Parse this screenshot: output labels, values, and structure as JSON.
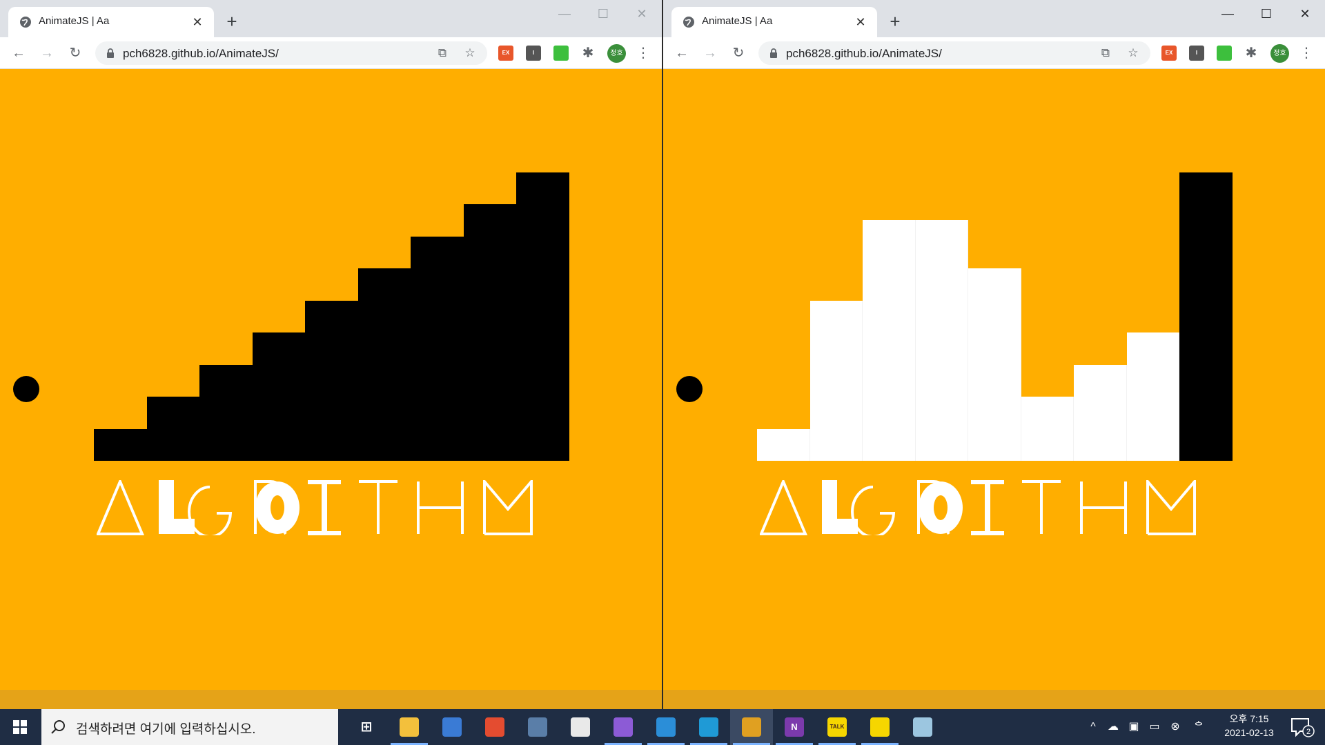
{
  "windows": [
    {
      "id": "left",
      "tab_title": "AnimateJS | Aa",
      "url": "pch6828.github.io/AnimateJS/",
      "avatar": "정호",
      "bars": [
        {
          "value": 1,
          "color": "#000000"
        },
        {
          "value": 2,
          "color": "#000000"
        },
        {
          "value": 3,
          "color": "#000000"
        },
        {
          "value": 4,
          "color": "#000000"
        },
        {
          "value": 5,
          "color": "#000000"
        },
        {
          "value": 6,
          "color": "#000000"
        },
        {
          "value": 7,
          "color": "#000000"
        },
        {
          "value": 8,
          "color": "#000000"
        },
        {
          "value": 9,
          "color": "#000000"
        }
      ],
      "logo_text": "ALGORITHM"
    },
    {
      "id": "right",
      "tab_title": "AnimateJS | Aa",
      "url": "pch6828.github.io/AnimateJS/",
      "avatar": "정호",
      "bars": [
        {
          "value": 1,
          "color": "#ffffff"
        },
        {
          "value": 5,
          "color": "#ffffff"
        },
        {
          "value": 7.5,
          "color": "#ffffff"
        },
        {
          "value": 7.5,
          "color": "#ffffff"
        },
        {
          "value": 6,
          "color": "#ffffff"
        },
        {
          "value": 2,
          "color": "#ffffff"
        },
        {
          "value": 3,
          "color": "#ffffff"
        },
        {
          "value": 4,
          "color": "#ffffff"
        },
        {
          "value": 9,
          "color": "#000000"
        }
      ],
      "logo_text": "ALGORITHM"
    }
  ],
  "colors": {
    "page_bg": "#ffae00",
    "bottom_strip": "#e5a318",
    "tabstrip": "#dee1e6",
    "taskbar": "#1f2d44",
    "avatar": "#3a8f3a"
  },
  "taskbar": {
    "search_placeholder": "검색하려면 여기에 입력하십시오.",
    "apps": [
      {
        "name": "task-view-icon",
        "color": "transparent",
        "label": "⊞"
      },
      {
        "name": "file-explorer-icon",
        "color": "#f3c03c",
        "label": ""
      },
      {
        "name": "remote-desktop-icon",
        "color": "#3a7bd5",
        "label": ""
      },
      {
        "name": "git-icon",
        "color": "#e44c30",
        "label": ""
      },
      {
        "name": "virtualbox-icon",
        "color": "#5a7ea8",
        "label": ""
      },
      {
        "name": "office-icon",
        "color": "#e9e9e9",
        "label": ""
      },
      {
        "name": "visual-studio-icon",
        "color": "#8c5bd6",
        "label": ""
      },
      {
        "name": "vscode-icon",
        "color": "#2b8ed8",
        "label": ""
      },
      {
        "name": "edge-icon",
        "color": "#1f9ad6",
        "label": ""
      },
      {
        "name": "chrome-icon",
        "color": "#e0a021",
        "label": ""
      },
      {
        "name": "onenote-icon",
        "color": "#7b3aac",
        "label": "N"
      },
      {
        "name": "kakaotalk-icon",
        "color": "#f6d600",
        "label": "TALK"
      },
      {
        "name": "sticky-notes-icon",
        "color": "#f6d600",
        "label": ""
      },
      {
        "name": "snipping-tool-icon",
        "color": "#9cc6e0",
        "label": ""
      }
    ],
    "clock_time": "오후 7:15",
    "clock_date": "2021-02-13",
    "notification_count": "2"
  }
}
